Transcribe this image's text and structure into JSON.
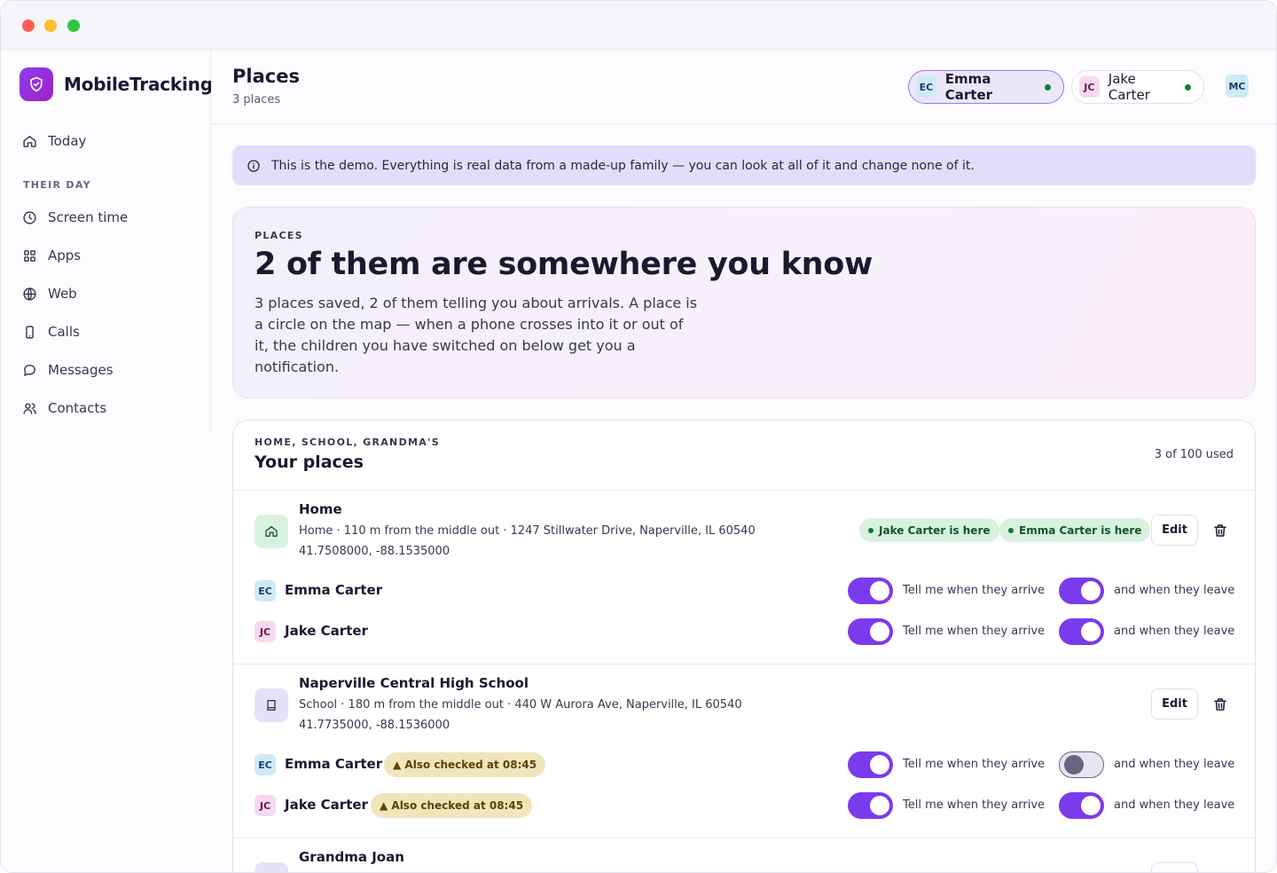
{
  "app": {
    "name": "MobileTracking"
  },
  "sidebar": {
    "today": "Today",
    "section": "THEIR DAY",
    "items": [
      {
        "label": "Screen time",
        "icon": "clock-icon"
      },
      {
        "label": "Apps",
        "icon": "grid-icon"
      },
      {
        "label": "Web",
        "icon": "globe-icon"
      },
      {
        "label": "Calls",
        "icon": "phone-icon"
      },
      {
        "label": "Messages",
        "icon": "message-icon"
      },
      {
        "label": "Contacts",
        "icon": "contacts-icon"
      }
    ]
  },
  "header": {
    "title": "Places",
    "subtitle": "3 places",
    "people": [
      {
        "initials": "EC",
        "name": "Emma Carter",
        "active": true
      },
      {
        "initials": "JC",
        "name": "Jake Carter",
        "active": false
      }
    ],
    "account_initials": "MC"
  },
  "banner": {
    "text": "This is the demo. Everything is real data from a made-up family — you can look at all of it and change none of it."
  },
  "hero": {
    "eyebrow": "PLACES",
    "title": "2 of them are somewhere you know",
    "description": "3 places saved, 2 of them telling you about arrivals. A place is a circle on the map — when a phone crosses into it or out of it, the children you have switched on below get you a notification."
  },
  "places_card": {
    "eyebrow": "HOME, SCHOOL, GRANDMA'S",
    "title": "Your places",
    "usage": "3 of 100 used",
    "edit_label": "Edit",
    "arrive_label": "Tell me when they arrive",
    "leave_label": "and when they leave",
    "places": [
      {
        "name": "Home",
        "meta": "Home · 110 m from the middle out · 1247 Stillwater Drive, Naperville, IL 60540",
        "coords": "41.7508000, -88.1535000",
        "icon": "home-icon",
        "here": [
          "Jake Carter is here",
          "Emma Carter is here"
        ],
        "children": [
          {
            "initials": "EC",
            "name": "Emma Carter",
            "arrive": true,
            "leave": true
          },
          {
            "initials": "JC",
            "name": "Jake Carter",
            "arrive": true,
            "leave": true
          }
        ]
      },
      {
        "name": "Naperville Central High School",
        "meta": "School · 180 m from the middle out · 440 W Aurora Ave, Naperville, IL 60540",
        "coords": "41.7735000, -88.1536000",
        "icon": "book-icon",
        "children": [
          {
            "initials": "EC",
            "name": "Emma Carter",
            "warning": "▲ Also checked at 08:45",
            "arrive": true,
            "leave": false
          },
          {
            "initials": "JC",
            "name": "Jake Carter",
            "warning": "▲ Also checked at 08:45",
            "arrive": true,
            "leave": true
          }
        ]
      },
      {
        "name": "Grandma Joan",
        "icon": "person-icon"
      }
    ]
  },
  "colors": {
    "accent": "#7c3aed",
    "here_badge": "#d8f2df",
    "warning_badge": "#f1e5bc",
    "banner": "#e3dcfa"
  }
}
